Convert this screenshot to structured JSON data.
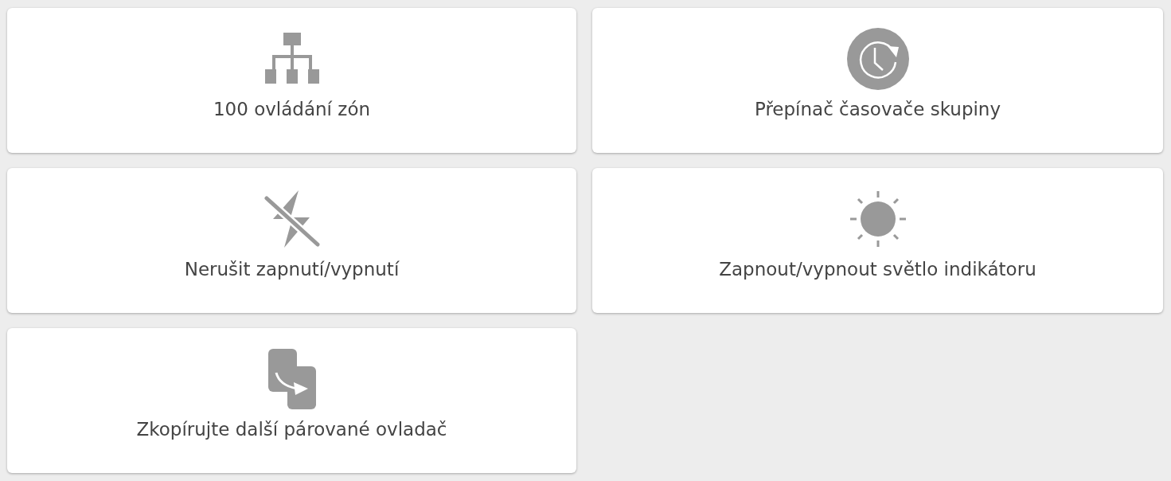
{
  "tiles": [
    {
      "kind": "hierarchy",
      "label": "100 ovládání zón"
    },
    {
      "kind": "timer",
      "label": "Přepínač časovače skupiny"
    },
    {
      "kind": "no-flash",
      "label": "Nerušit zapnutí/vypnutí"
    },
    {
      "kind": "sun",
      "label": "Zapnout/vypnout světlo indikátoru"
    },
    {
      "kind": "copy",
      "label": "Zkopírujte další párované ovladač"
    }
  ]
}
